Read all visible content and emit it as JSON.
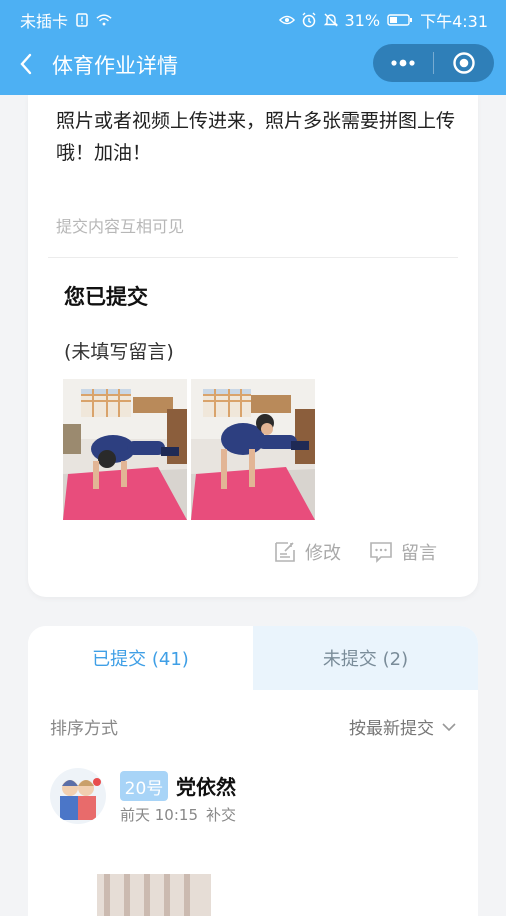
{
  "status_bar": {
    "carrier": "未插卡",
    "battery": "31%",
    "time": "下午4:31"
  },
  "nav": {
    "title": "体育作业详情"
  },
  "assignment": {
    "description": "照片或者视频上传进来，照片多张需要拼图上传哦！加油！",
    "visibility_hint": "提交内容互相可见"
  },
  "my_submission": {
    "title": "您已提交",
    "comment": "(未填写留言)",
    "actions": {
      "edit": "修改",
      "comment": "留言"
    }
  },
  "tabs": [
    {
      "label": "已提交 (41)"
    },
    {
      "label": "未提交 (2)"
    }
  ],
  "sort": {
    "label": "排序方式",
    "value": "按最新提交"
  },
  "submission_item": {
    "number_badge": "20号",
    "name": "党依然",
    "time": "前天 10:15",
    "tag": "补交"
  },
  "colors": {
    "header_blue": "#4db0f3",
    "tab_active": "#3f9fe6",
    "badge_blue": "#a8d4f7"
  },
  "icons": {
    "back": "chevron-left-icon",
    "more": "more-dots-icon",
    "close_target": "target-circle-icon",
    "edit": "edit-icon",
    "comment": "comment-icon",
    "sort_arrow": "chevron-down-icon"
  }
}
